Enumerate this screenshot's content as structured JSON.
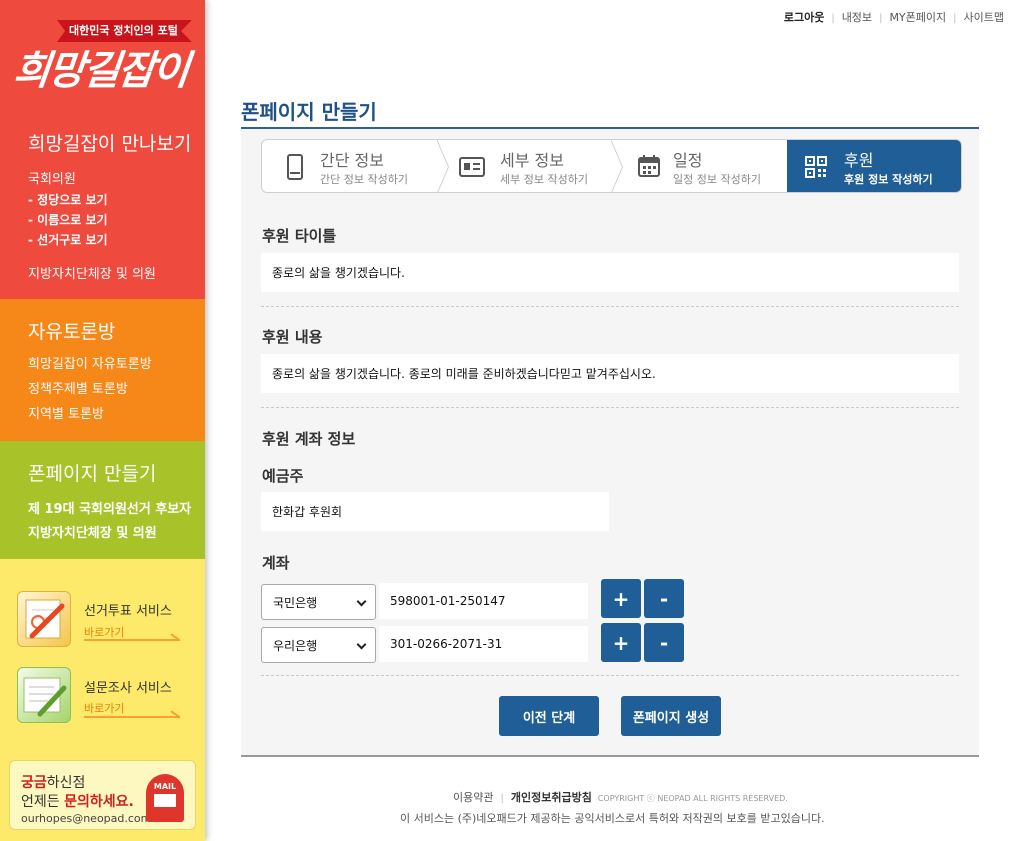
{
  "sidebar": {
    "logo_tagline": "대한민국 정치인의 포털",
    "logo_text": "희망길잡이",
    "meet": {
      "title": "희망길잡이 만나보기",
      "assembly": "국회의원",
      "by_party": "-  정당으로 보기",
      "by_name": "-  이름으로 보기",
      "by_district": "-  선거구로 보기",
      "local_heads": "지방자치단체장 및 의원"
    },
    "forum": {
      "title": "자유토론방",
      "items": [
        "희망길잡이 자유토론방",
        "정책주제별 토론방",
        "지역별 토론방"
      ]
    },
    "phonepage": {
      "title": "폰페이지 만들기",
      "items": [
        "제 19대 국회의원선거 후보자",
        "지방자치단체장 및 의원"
      ]
    },
    "services": [
      {
        "title": "선거투표 서비스",
        "go": "바로가기",
        "icon": "vote-pencil-icon"
      },
      {
        "title": "설문조사 서비스",
        "go": "바로가기",
        "icon": "survey-pencil-icon"
      }
    ],
    "contact": {
      "l1_hl": "궁금",
      "l1_rest": "하신점",
      "l2_pre": "언제든 ",
      "l2_hl": "문의하세요.",
      "email": "ourhopes@neopad.com",
      "mail_label": "MAIL"
    }
  },
  "toplinks": [
    "로그아웃",
    "내정보",
    "MY폰페이지",
    "사이트맵"
  ],
  "page_title": "폰페이지 만들기",
  "steps": [
    {
      "title": "간단 정보",
      "sub": "간단 정보 작성하기",
      "icon": "phone-icon",
      "active": false
    },
    {
      "title": "세부 정보",
      "sub": "세부 정보 작성하기",
      "icon": "id-card-icon",
      "active": false
    },
    {
      "title": "일정",
      "sub": "일정 정보 작성하기",
      "icon": "calendar-icon",
      "active": false
    },
    {
      "title": "후원",
      "sub": "후원 정보 작성하기",
      "icon": "qr-code-icon",
      "active": true
    }
  ],
  "form": {
    "title_label": "후원 타이틀",
    "title_value": "종로의 삶을 챙기겠습니다.",
    "content_label": "후원 내용",
    "content_value": "종로의 삶을 챙기겠습니다. 종로의 미래를 준비하겠습니다믿고 맡겨주십시오.",
    "account_section": "후원 계좌 정보",
    "holder_label": "예금주",
    "holder_value": "한화갑 후원회",
    "account_label": "계좌",
    "accounts": [
      {
        "bank": "국민은행",
        "number": "598001-01-250147"
      },
      {
        "bank": "우리은행",
        "number": "301-0266-2071-31"
      }
    ],
    "plus": "+",
    "minus": "-"
  },
  "buttons": {
    "prev": "이전 단계",
    "create": "폰페이지 생성"
  },
  "footer": {
    "terms": "이용약관",
    "privacy": "개인정보취급방침",
    "copyright": "COPYRIGHT ⓒ NEOPAD ALL RIGHTS RESERVED.",
    "note": "이 서비스는 (주)네오패드가 제공하는 공익서비스로서 특허와 저작권의 보호를 받고있습니다."
  }
}
